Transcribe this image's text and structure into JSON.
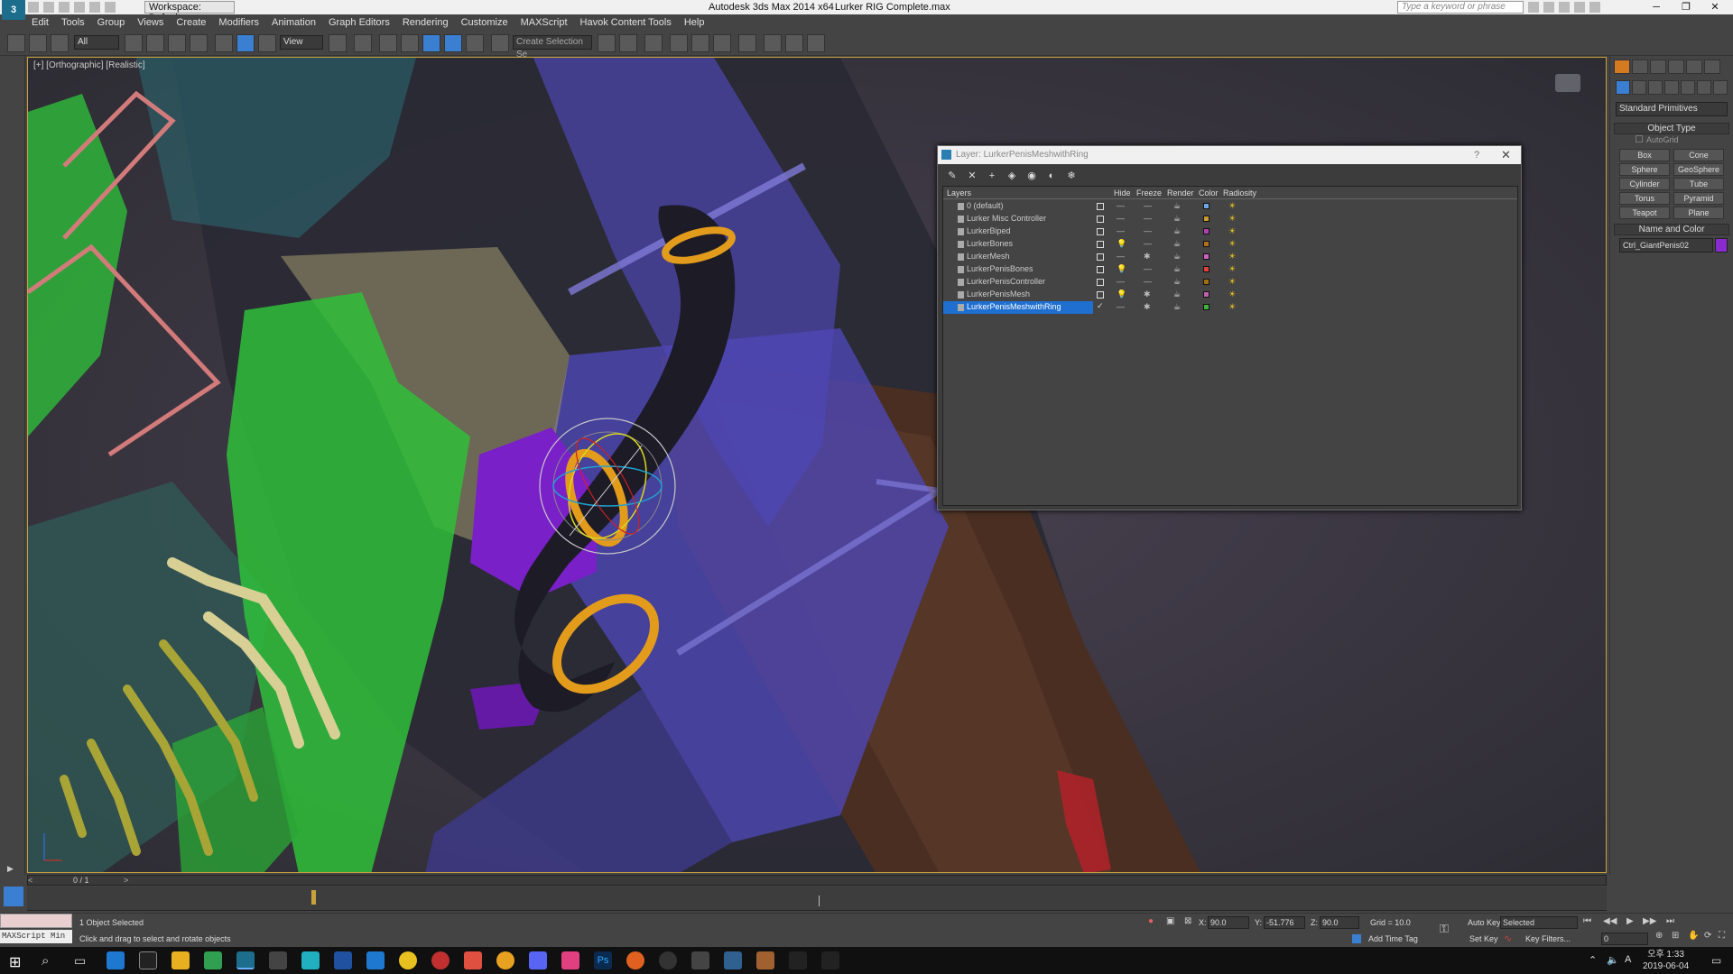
{
  "titlebar": {
    "workspace": "Workspace: Default",
    "app_title": "Autodesk 3ds Max  2014 x64",
    "file_title": "Lurker RIG Complete.max",
    "search_placeholder": "Type a keyword or phrase",
    "minimize": "─",
    "restore": "❐",
    "close": "✕"
  },
  "menu": [
    "Edit",
    "Tools",
    "Group",
    "Views",
    "Create",
    "Modifiers",
    "Animation",
    "Graph Editors",
    "Rendering",
    "Customize",
    "MAXScript",
    "Havok Content Tools",
    "Help"
  ],
  "toolbar": {
    "filter_value": "All",
    "refcoord_value": "View",
    "selection_set_value": "Create Selection Se"
  },
  "viewport": {
    "label": "[+] [Orthographic] [Realistic]"
  },
  "command_panel": {
    "category_value": "Standard Primitives",
    "object_type_title": "Object Type",
    "autogrid_label": "AutoGrid",
    "primitives": [
      "Box",
      "Cone",
      "Sphere",
      "GeoSphere",
      "Cylinder",
      "Tube",
      "Torus",
      "Pyramid",
      "Teapot",
      "Plane"
    ],
    "name_color_title": "Name and Color",
    "object_name": "Ctrl_GiantPenis02",
    "object_color": "#8a2bd1"
  },
  "layer_dialog": {
    "title": "Layer: LurkerPenisMeshwithRing",
    "help": "?",
    "close": "✕",
    "tool_icons": [
      "new-layer-icon",
      "delete-icon",
      "add-selection-icon",
      "select-objects-icon",
      "highlight-icon",
      "hide-all-icon",
      "freeze-all-icon"
    ],
    "headers": {
      "layers": "Layers",
      "hide": "Hide",
      "freeze": "Freeze",
      "render": "Render",
      "color": "Color",
      "radiosity": "Radiosity"
    },
    "rows": [
      {
        "name": "0 (default)",
        "hide": "—",
        "freeze": "—",
        "color": "#6fa8e8",
        "selected": false
      },
      {
        "name": "Lurker Misc Controller",
        "hide": "—",
        "freeze": "—",
        "color": "#c89c30",
        "selected": false
      },
      {
        "name": "LurkerBiped",
        "hide": "—",
        "freeze": "—",
        "color": "#b040b0",
        "selected": false
      },
      {
        "name": "LurkerBones",
        "hide": "💡",
        "freeze": "—",
        "color": "#b07020",
        "selected": false
      },
      {
        "name": "LurkerMesh",
        "hide": "—",
        "freeze": "✱",
        "color": "#d060c0",
        "selected": false
      },
      {
        "name": "LurkerPenisBones",
        "hide": "💡",
        "freeze": "—",
        "color": "#e04040",
        "selected": false
      },
      {
        "name": "LurkerPenisController",
        "hide": "—",
        "freeze": "—",
        "color": "#a07010",
        "selected": false
      },
      {
        "name": "LurkerPenisMesh",
        "hide": "💡",
        "freeze": "✱",
        "color": "#c060b0",
        "selected": false
      },
      {
        "name": "LurkerPenisMeshwithRing",
        "hide": "—",
        "freeze": "✱",
        "color": "#40b040",
        "selected": true
      }
    ]
  },
  "timeline": {
    "frame_label": "0 / 1"
  },
  "status": {
    "maxscript_label": "MAXScript Min",
    "selection_text": "1 Object Selected",
    "prompt_text": "Click and drag to select and rotate objects",
    "x_label": "X:",
    "x_value": "90.0",
    "y_label": "Y:",
    "y_value": "-51.776",
    "z_label": "Z:",
    "z_value": "90.0",
    "grid": "Grid = 10.0",
    "add_time_tag": "Add Time Tag",
    "auto_key": "Auto Key",
    "set_key": "Set Key",
    "key_mode_value": "Selected",
    "key_filters": "Key Filters...",
    "frame_value": "0"
  },
  "taskbar": {
    "time": "오후 1:33",
    "date": "2019-06-04"
  }
}
